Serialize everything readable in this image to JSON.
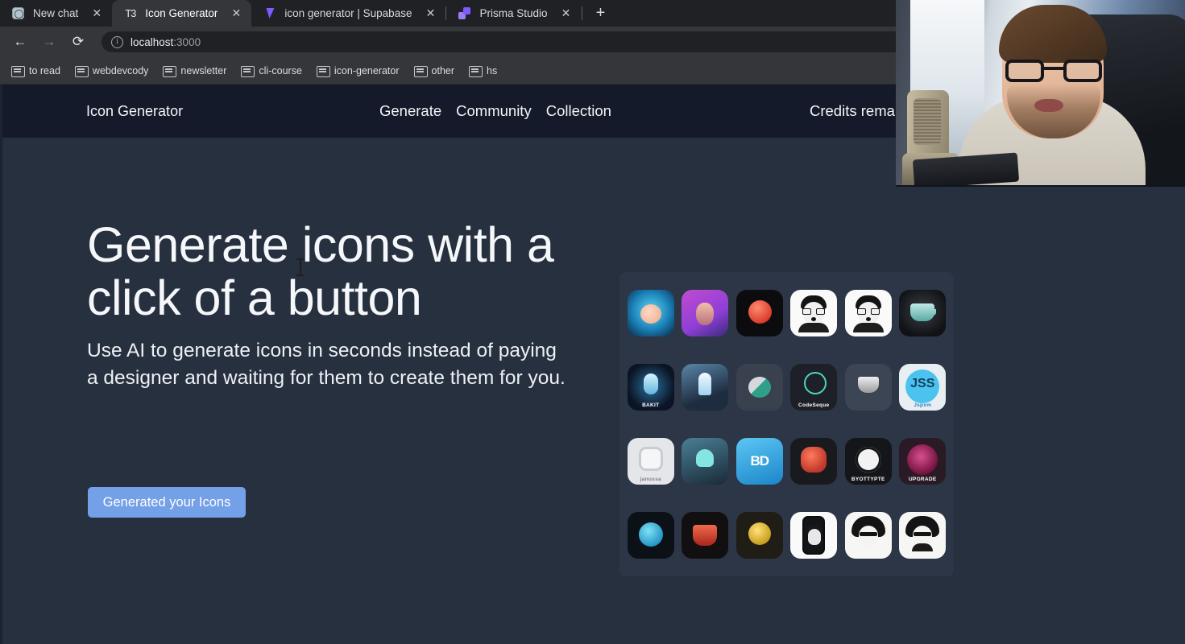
{
  "browser": {
    "tabs": [
      {
        "title": "New chat",
        "favicon": "chatgpt-icon",
        "active": false
      },
      {
        "title": "Icon Generator",
        "favicon": "t3-icon",
        "active": true
      },
      {
        "title": "icon generator | Supabase",
        "favicon": "supabase-icon",
        "active": false
      },
      {
        "title": "Prisma Studio",
        "favicon": "prisma-icon",
        "active": false
      }
    ],
    "close_label": "✕",
    "new_tab_label": "+",
    "toolbar": {
      "back_label": "←",
      "forward_label": "→",
      "reload_label": "⟳",
      "info_label": "i",
      "url_host": "localhost",
      "url_port": ":3000"
    },
    "bookmarks": [
      {
        "label": "to read"
      },
      {
        "label": "webdevcody"
      },
      {
        "label": "newsletter"
      },
      {
        "label": "cli-course"
      },
      {
        "label": "icon-generator"
      },
      {
        "label": "other"
      },
      {
        "label": "hs"
      }
    ]
  },
  "site": {
    "brand": "Icon Generator",
    "nav": [
      {
        "label": "Generate"
      },
      {
        "label": "Community"
      },
      {
        "label": "Collection"
      }
    ],
    "credits": "Credits remain",
    "hero": {
      "title": "Generate icons with a click of a button",
      "subtitle": "Use AI to generate icons in seconds instead of paying a designer and waiting for them to create them for you.",
      "cta": "Generated your Icons"
    },
    "icon_grid": [
      {
        "name": "blue-hair-character-icon",
        "class": "i1",
        "label": ""
      },
      {
        "name": "purple-portrait-icon",
        "class": "i2",
        "label": ""
      },
      {
        "name": "red-sphere-icon",
        "class": "i3",
        "label": ""
      },
      {
        "name": "bearded-glasses-avatar-icon",
        "class": "i4",
        "label": ""
      },
      {
        "name": "curly-glasses-avatar-icon",
        "class": "i5",
        "label": ""
      },
      {
        "name": "teal-coffee-cup-icon",
        "class": "i6",
        "label": ""
      },
      {
        "name": "microphone-podcast-icon",
        "class": "i7",
        "label": "BAKIT"
      },
      {
        "name": "rocket-launch-icon",
        "class": "i8",
        "label": ""
      },
      {
        "name": "leaf-disc-icon",
        "class": "i9",
        "label": ""
      },
      {
        "name": "codeseque-badge-icon",
        "class": "i10",
        "label": "CodeSeque"
      },
      {
        "name": "silver-coffee-cup-icon",
        "class": "i11",
        "label": ""
      },
      {
        "name": "jss-logo-icon",
        "class": "i12",
        "label": "Jspxm",
        "text": "JSS"
      },
      {
        "name": "jetbrains-j-icon",
        "class": "i13",
        "label": "janussa"
      },
      {
        "name": "teal-ghost-mask-icon",
        "class": "i14",
        "label": ""
      },
      {
        "name": "bd-monogram-icon",
        "class": "i15",
        "label": "",
        "text": "BD"
      },
      {
        "name": "red-coffee-machine-icon",
        "class": "i16",
        "label": ""
      },
      {
        "name": "byottypte-emblem-icon",
        "class": "i17",
        "label": "BYOTTYPTE"
      },
      {
        "name": "upgrade-badge-icon",
        "class": "i18",
        "label": "UPGRADE"
      },
      {
        "name": "blue-orb-icon",
        "class": "i19",
        "label": ""
      },
      {
        "name": "red-steaming-mug-icon",
        "class": "i20",
        "label": ""
      },
      {
        "name": "gold-coin-icon",
        "class": "i21",
        "label": ""
      },
      {
        "name": "phone-portrait-icon",
        "class": "i22",
        "label": ""
      },
      {
        "name": "afro-sunglasses-avatar-icon",
        "class": "i23",
        "label": ""
      },
      {
        "name": "afro-beard-avatar-icon",
        "class": "i24",
        "label": ""
      }
    ]
  },
  "colors": {
    "page_bg": "#27303f",
    "nav_bg": "#141a2a",
    "cta_bg": "#74a0e8",
    "grid_bg": "#2c3646",
    "chrome_tabstrip": "#202124",
    "chrome_toolbar": "#35363a"
  }
}
